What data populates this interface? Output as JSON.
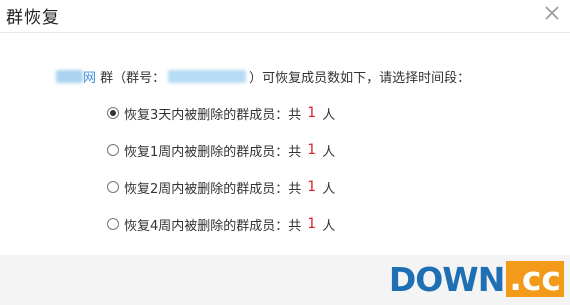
{
  "dialog": {
    "title": "群恢复",
    "close_icon": "close-icon"
  },
  "intro": {
    "group_name_visible": "网",
    "text_group": "群（群号：",
    "text_rest": "）可恢复成员数如下，请选择时间段："
  },
  "options": [
    {
      "label": "恢复3天内被删除的群成员：共",
      "count": "1",
      "unit": "人",
      "checked": true
    },
    {
      "label": "恢复1周内被删除的群成员：共",
      "count": "1",
      "unit": "人",
      "checked": false
    },
    {
      "label": "恢复2周内被删除的群成员：共",
      "count": "1",
      "unit": "人",
      "checked": false
    },
    {
      "label": "恢复4周内被删除的群成员：共",
      "count": "1",
      "unit": "人",
      "checked": false
    }
  ],
  "watermark": {
    "brand": "DOWN",
    "tld": ".cc"
  },
  "colors": {
    "accent_red": "#d9252b",
    "link_blue": "#3a8ed6",
    "watermark_blue": "#1e6fb4",
    "watermark_orange": "#f39a1a"
  }
}
